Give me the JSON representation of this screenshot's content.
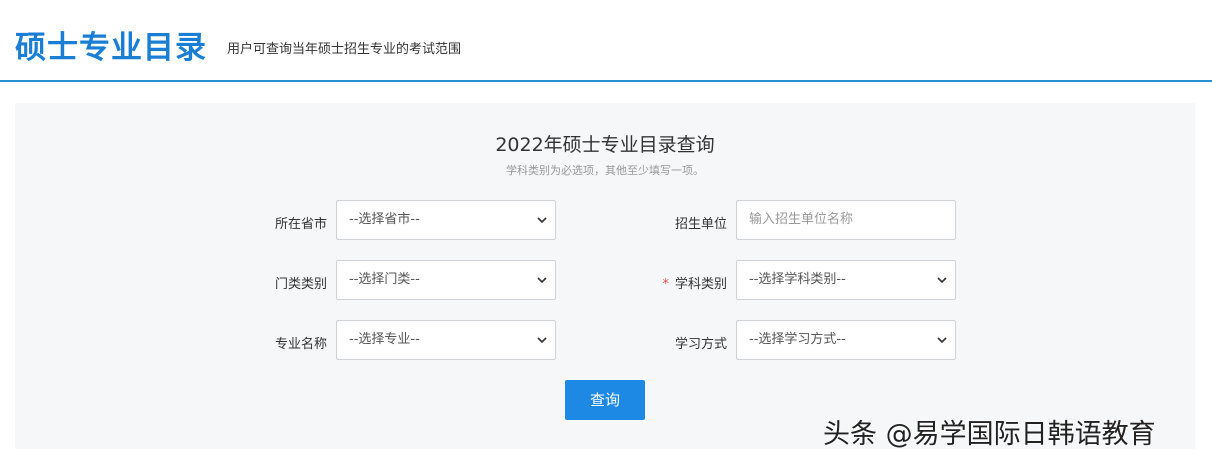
{
  "header": {
    "title": "硕士专业目录",
    "subtitle": "用户可查询当年硕士招生专业的考试范围"
  },
  "form": {
    "title": "2022年硕士专业目录查询",
    "hint": "学科类别为必选项，其他至少填写一项。",
    "fields": {
      "province": {
        "label": "所在省市",
        "value": "--选择省市--"
      },
      "unit": {
        "label": "招生单位",
        "placeholder": "输入招生单位名称"
      },
      "category": {
        "label": "门类类别",
        "value": "--选择门类--"
      },
      "discipline": {
        "label": "学科类别",
        "required_mark": "*",
        "value": "--选择学科类别--"
      },
      "major": {
        "label": "专业名称",
        "value": "--选择专业--"
      },
      "study_mode": {
        "label": "学习方式",
        "value": "--选择学习方式--"
      }
    },
    "submit_label": "查询"
  },
  "watermark": "头条 @易学国际日韩语教育",
  "colors": {
    "brand": "#1a7fd4",
    "header_border": "#2a8fd0",
    "button": "#1e88e5",
    "panel_bg": "#f6f7f9",
    "required": "#e05050"
  },
  "icons": {
    "select_arrow": "chevron-down-icon"
  }
}
